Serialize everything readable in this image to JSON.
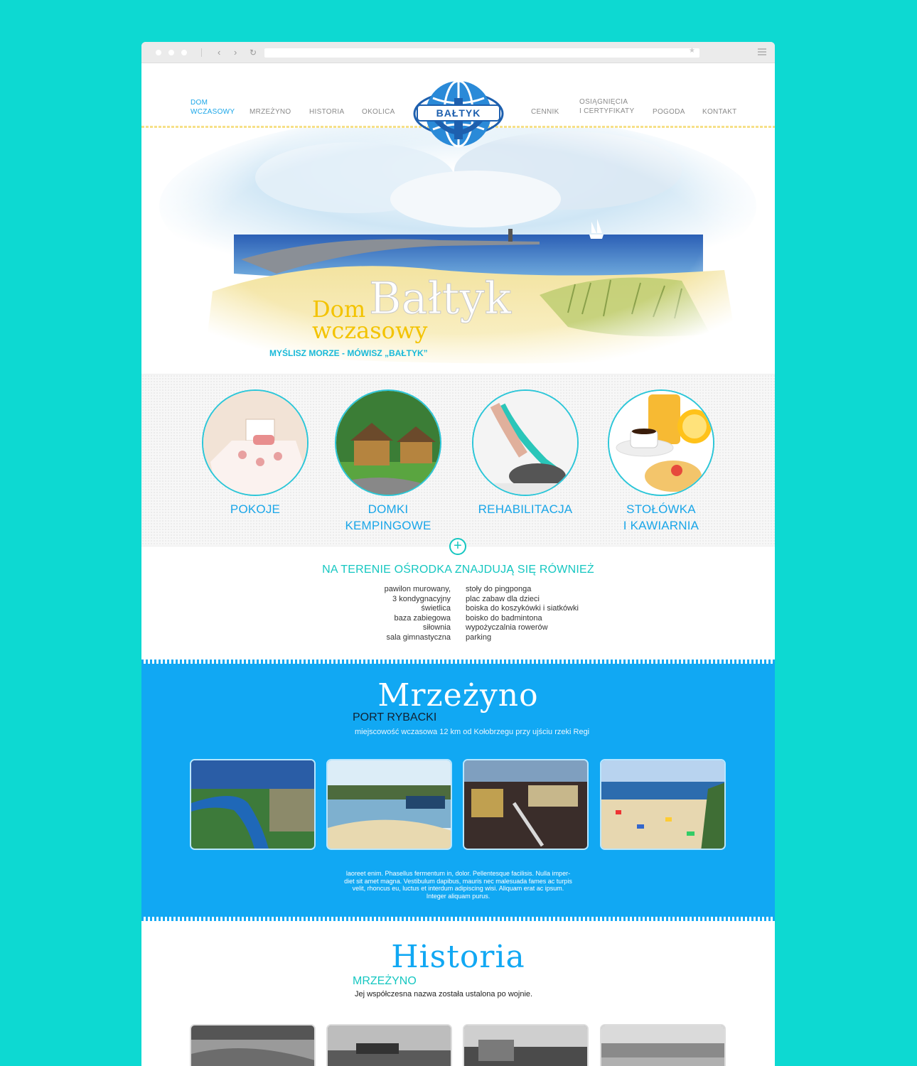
{
  "nav": {
    "left": [
      "DOM",
      "WCZASOWY",
      "MRZEŻYNO",
      "HISTORIA",
      "OKOLICA"
    ],
    "right": [
      "CENNIK",
      "OSIĄGNIĘCIA",
      "I CERTYFIKATY",
      "POGODA",
      "KONTAKT"
    ]
  },
  "logo": {
    "text": "BAŁTYK"
  },
  "hero": {
    "line1": "Dom",
    "line2": "wczasowy",
    "brand": "Bałtyk",
    "tagline": "MYŚLISZ MORZE - MÓWISZ „BAŁTYK”"
  },
  "features": [
    {
      "line1": "POKOJE",
      "line2": ""
    },
    {
      "line1": "DOMKI",
      "line2": "KEMPINGOWE"
    },
    {
      "line1": "REHABILITACJA",
      "line2": ""
    },
    {
      "line1": "STOŁÓWKA",
      "line2": "I KAWIARNIA"
    }
  ],
  "amenities": {
    "title": "NA TERENIE OŚRODKA ZNAJDUJĄ SIĘ RÓWNIEŻ",
    "left": [
      "pawilon murowany,",
      "3 kondygnacyjny",
      "świetlica",
      "baza zabiegowa",
      "siłownia",
      "sala gimnastyczna"
    ],
    "right": [
      "stoły do pingponga",
      "plac zabaw dla dzieci",
      "boiska do koszykówki i siatkówki",
      "boisko do badmintona",
      "wypożyczalnia rowerów",
      "parking"
    ]
  },
  "mrzezyno": {
    "title": "Mrzeżyno",
    "subtitle": "PORT RYBACKI",
    "desc": "miejscowość wczasowa 12 km od Kołobrzegu przy ujściu rzeki Regi",
    "lorem": [
      "laoreet enim. Phasellus fermentum in, dolor. Pellentesque facilisis. Nulla imper-",
      "diet sit amet magna. Vestibulum dapibus, mauris nec malesuada fames ac turpis",
      "velit, rhoncus eu, luctus et interdum adipiscing wisi. Aliquam erat ac ipsum.",
      "Integer aliquam purus."
    ]
  },
  "historia": {
    "title": "Historia",
    "subtitle": "MRZEŻYNO",
    "desc": "Jej współczesna nazwa została ustalona po wojnie."
  },
  "colors": {
    "accent": "#11a8f3",
    "teal": "#16c7c1",
    "yellow": "#f3c300",
    "bg": "#0dd9d2"
  }
}
